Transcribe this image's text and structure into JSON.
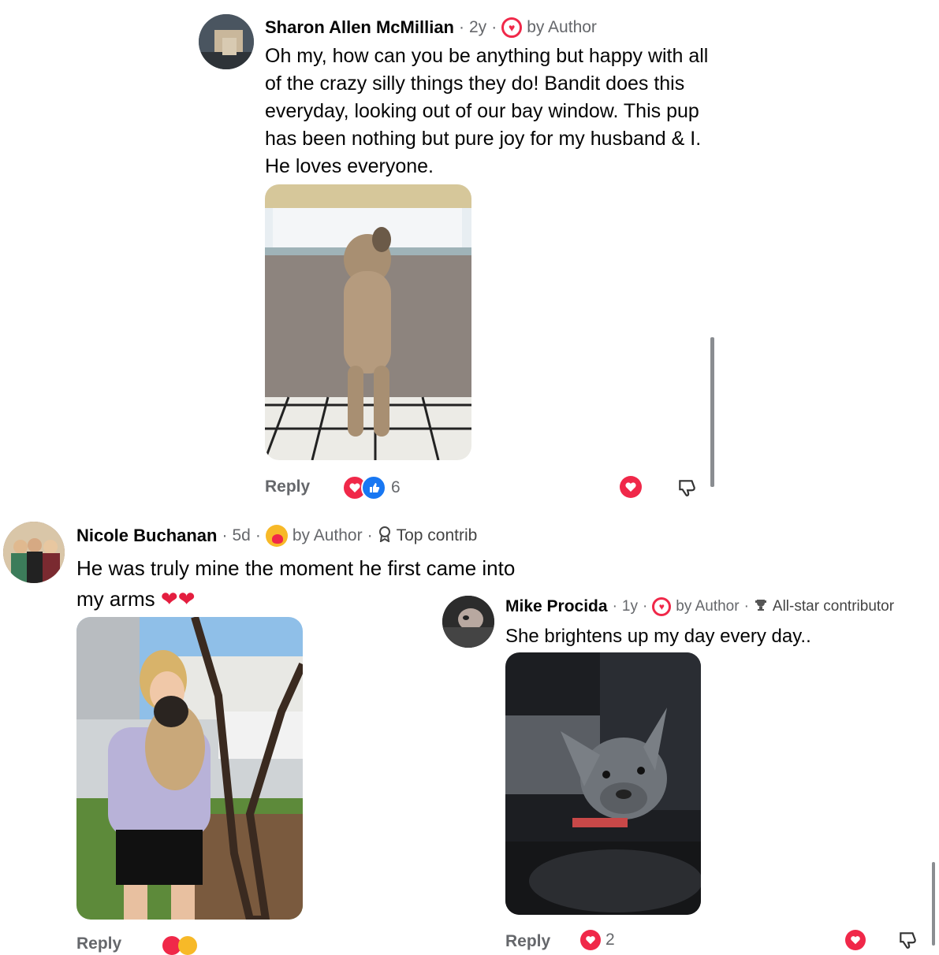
{
  "comment1": {
    "name": "Sharon Allen McMillian",
    "time": "2y",
    "badge": "by Author",
    "text": "Oh my, how can you be anything but happy with all of the crazy silly things they do! Bandit does this everyday, looking out of our bay window. This pup has been nothing but pure joy for my husband &  I. He loves everyone.",
    "reply_label": "Reply",
    "reaction_count": "6"
  },
  "comment2": {
    "name": "Nicole Buchanan",
    "time": "5d",
    "badge": "by Author",
    "top_badge": "Top contrib",
    "text": "He was truly mine the moment he first came into my arms"
  },
  "comment3": {
    "name": "Mike Procida",
    "time": "1y",
    "badge": "by Author",
    "top_badge": "All-star contributor",
    "text": "She brightens up my day every day..",
    "reply_label": "Reply",
    "reaction_count": "2"
  },
  "colors": {
    "heart": "#f02849",
    "like": "#1877f2",
    "secondary_text": "#65676b"
  },
  "icons": [
    "heart-icon",
    "thumbs-up-icon",
    "thumbs-down-icon",
    "trophy-icon",
    "award-icon"
  ]
}
